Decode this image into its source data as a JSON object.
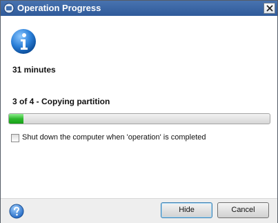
{
  "window": {
    "title": "Operation Progress"
  },
  "icons": {
    "app": "app-icon",
    "info": "info-icon",
    "help": "help-icon",
    "close": "close-icon"
  },
  "status": {
    "time_remaining": "31 minutes",
    "step": "3 of 4 - Copying partition"
  },
  "progress": {
    "fraction": 0.055,
    "color": "#2fb82f"
  },
  "shutdown_option": {
    "label": "Shut down the computer when 'operation' is completed",
    "checked": false
  },
  "buttons": {
    "hide": "Hide",
    "cancel": "Cancel"
  }
}
